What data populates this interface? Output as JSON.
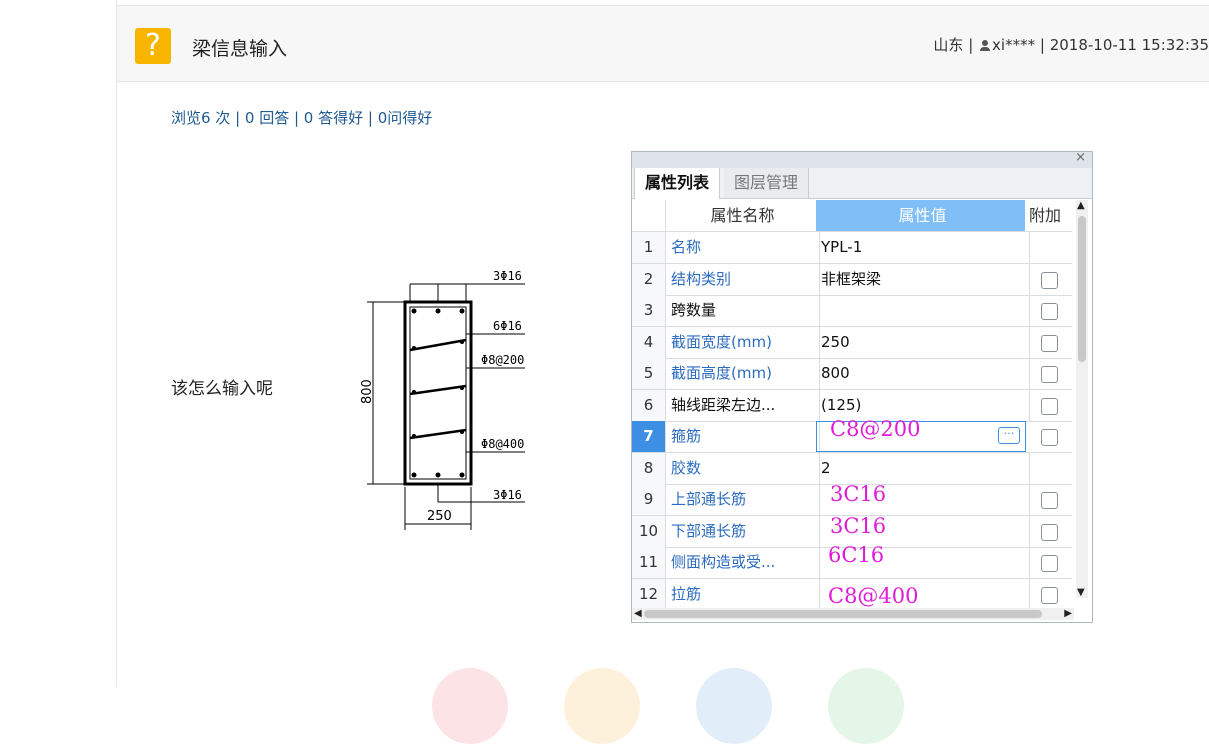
{
  "header": {
    "icon_glyph": "?",
    "title": "梁信息输入",
    "location": "山东",
    "user": "xi****",
    "datetime": "2018-10-11 15:32:35"
  },
  "stats": "浏览6 次 | 0 回答 | 0 答得好 | 0问得好",
  "question": "该怎么输入呢",
  "drawing": {
    "top_bar": "3Φ16",
    "side_bar": "6Φ16",
    "stirrup_top": "Φ8@200",
    "stirrup_bottom": "Φ8@400",
    "bottom_bar": "3Φ16",
    "height": "800",
    "width": "250"
  },
  "panel": {
    "close": "×",
    "tabs": [
      "属性列表",
      "图层管理"
    ],
    "columns": [
      "属性名称",
      "属性值",
      "附加"
    ],
    "rows": [
      {
        "num": "1",
        "name": "名称",
        "value": "YPL-1",
        "checkbox": false,
        "name_color": "blue"
      },
      {
        "num": "2",
        "name": "结构类别",
        "value": "非框架梁",
        "checkbox": true,
        "name_color": "blue"
      },
      {
        "num": "3",
        "name": "跨数量",
        "value": "",
        "checkbox": true,
        "name_color": "black"
      },
      {
        "num": "4",
        "name": "截面宽度(mm)",
        "value": "250",
        "checkbox": true,
        "name_color": "blue"
      },
      {
        "num": "5",
        "name": "截面高度(mm)",
        "value": "800",
        "checkbox": true,
        "name_color": "blue"
      },
      {
        "num": "6",
        "name": "轴线距梁左边...",
        "value": "(125)",
        "checkbox": true,
        "name_color": "black"
      },
      {
        "num": "7",
        "name": "箍筋",
        "value": "",
        "checkbox": true,
        "name_color": "blue"
      },
      {
        "num": "8",
        "name": "胶数",
        "value": "2",
        "checkbox": false,
        "name_color": "blue"
      },
      {
        "num": "9",
        "name": "上部通长筋",
        "value": "",
        "checkbox": true,
        "name_color": "blue"
      },
      {
        "num": "10",
        "name": "下部通长筋",
        "value": "",
        "checkbox": true,
        "name_color": "blue"
      },
      {
        "num": "11",
        "name": "侧面构造或受...",
        "value": "",
        "checkbox": true,
        "name_color": "blue"
      },
      {
        "num": "12",
        "name": "拉筋",
        "value": "",
        "checkbox": true,
        "name_color": "blue"
      }
    ],
    "handwritten": [
      "C8@200",
      "3C16",
      "3C16",
      "6C16",
      "C8@400"
    ],
    "ellipsis": "···"
  }
}
